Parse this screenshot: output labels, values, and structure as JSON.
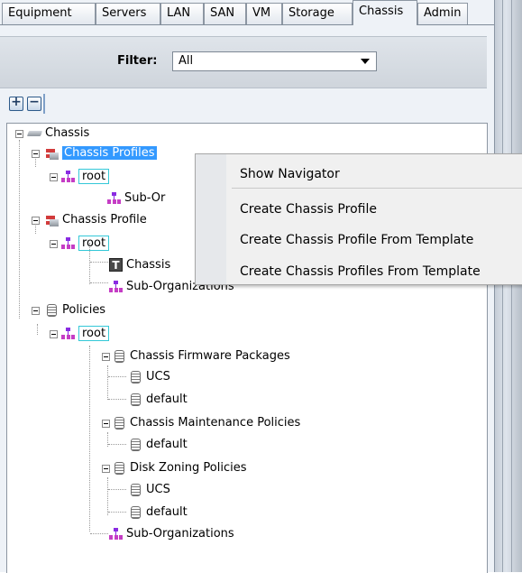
{
  "tabs": [
    "Equipment",
    "Servers",
    "LAN",
    "SAN",
    "VM",
    "Storage",
    "Chassis",
    "Admin"
  ],
  "active_tab": "Chassis",
  "filter": {
    "label": "Filter:",
    "value": "All"
  },
  "toolbar": {
    "expand_icon": "plus-icon",
    "collapse_icon": "minus-icon"
  },
  "tree": {
    "chassis": "Chassis",
    "chassis_profiles": "Chassis Profiles",
    "root_1": "root",
    "sub_org_1": "Sub-Or",
    "chassis_profile_templates": "Chassis Profile",
    "root_2": "root",
    "chassis_template_item": "Chassis",
    "sub_org_2": "Sub-Organizations",
    "policies": "Policies",
    "root_3": "root",
    "firmware_packages": "Chassis Firmware Packages",
    "fw_ucs": "UCS",
    "fw_default": "default",
    "maintenance_policies": "Chassis Maintenance Policies",
    "mp_default": "default",
    "disk_zoning": "Disk Zoning Policies",
    "dz_ucs": "UCS",
    "dz_default": "default",
    "sub_org_3": "Sub-Organizations"
  },
  "context_menu": {
    "items": [
      "Show Navigator",
      "Create Chassis Profile",
      "Create Chassis Profile From Template",
      "Create Chassis Profiles From Template"
    ]
  },
  "colors": {
    "selection": "#3399ff",
    "focus_box": "#34c8d8"
  }
}
